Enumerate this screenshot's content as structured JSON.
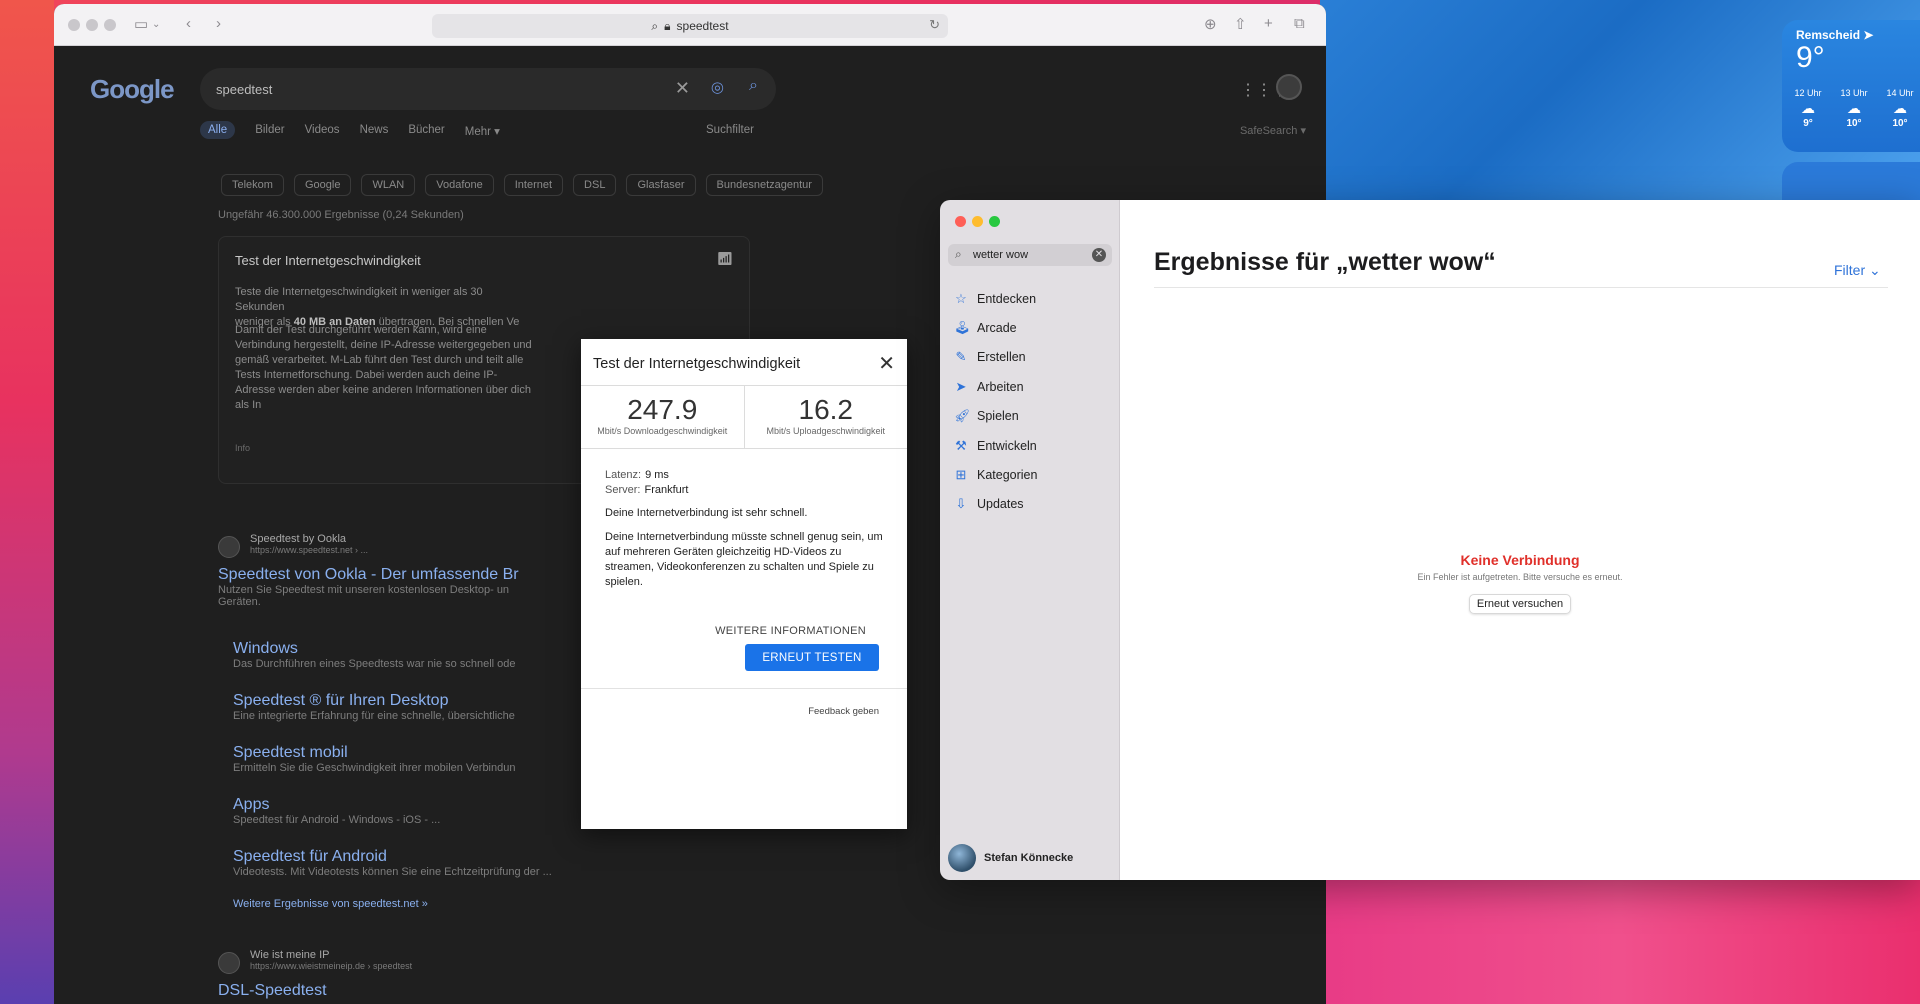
{
  "safari": {
    "url": "speedtest",
    "google": {
      "logo": "Google",
      "query": "speedtest",
      "tabs": [
        "Alle",
        "Bilder",
        "Videos",
        "News",
        "Bücher",
        "Mehr ▾"
      ],
      "filter_label": "Suchfilter",
      "safesearch": "SafeSearch ▾",
      "chips": [
        "Telekom",
        "Google",
        "WLAN",
        "Vodafone",
        "Internet",
        "DSL",
        "Glasfaser",
        "Bundesnetzagentur"
      ],
      "result_count": "Ungefähr 46.300.000 Ergebnisse (0,24 Sekunden)",
      "card": {
        "title": "Test der Internetgeschwindigkeit",
        "p1_line1": "Teste die Internetgeschwindigkeit in weniger als 30 Sekunden",
        "p1_line2_a": "weniger als ",
        "p1_line2_b": "40 MB an Daten",
        "p1_line2_c": " übertragen. Bei schnellen Ve",
        "p2": "Damit der Test durchgeführt werden kann, wird eine Verbindung hergestellt, deine IP-Adresse weitergegeben und gemäß verarbeitet. M-Lab führt den Test durch und teilt alle Tests Internetforschung. Dabei werden auch deine IP-Adresse werden aber keine anderen Informationen über dich als In",
        "info": "Info"
      },
      "results": {
        "ookla_site": "Speedtest by Ookla",
        "ookla_url": "https://www.speedtest.net › ...",
        "ookla_title": "Speedtest von Ookla - Der umfassende Br",
        "ookla_snip": "Nutzen Sie Speedtest mit unseren kostenlosen Desktop- un",
        "ookla_snip2": "Geräten.",
        "sub1_title": "Windows",
        "sub1_snip": "Das Durchführen eines Speedtests war nie so schnell ode",
        "sub2_title": "Speedtest ® für Ihren Desktop",
        "sub2_snip": "Eine integrierte Erfahrung für eine schnelle, übersichtliche",
        "sub3_title": "Speedtest mobil",
        "sub3_snip": "Ermitteln Sie die Geschwindigkeit ihrer mobilen Verbindun",
        "sub4_title": "Apps",
        "sub4_snip": "Speedtest für Android - Windows - iOS - ...",
        "sub5_title": "Speedtest für Android",
        "sub5_snip": "Videotests. Mit Videotests können Sie eine Echtzeitprüfung der ...",
        "more": "Weitere Ergebnisse von speedtest.net »",
        "wie_site": "Wie ist meine IP",
        "wie_url": "https://www.wieistmeineip.de › speedtest",
        "wie_title": "DSL-Speedtest"
      }
    },
    "dialog": {
      "title": "Test der Internetgeschwindigkeit",
      "download_value": "247.9",
      "download_label": "Mbit/s Downloadgeschwindigkeit",
      "upload_value": "16.2",
      "upload_label": "Mbit/s Uploadgeschwindigkeit",
      "latency_label": "Latenz:",
      "latency_value": "9 ms",
      "server_label": "Server:",
      "server_value": "Frankfurt",
      "verdict": "Deine Internetverbindung ist sehr schnell.",
      "description": "Deine Internetverbindung müsste schnell genug sein, um auf mehreren Geräten gleichzeitig HD-Videos zu streamen, Videokonferenzen zu schalten und Spiele zu spielen.",
      "more_info": "WEITERE INFORMATIONEN",
      "retest": "ERNEUT TESTEN",
      "feedback": "Feedback geben"
    }
  },
  "weather": {
    "city": "Remscheid ➤",
    "temp": "9°",
    "hours": [
      {
        "time": "12 Uhr",
        "temp": "9°"
      },
      {
        "time": "13 Uhr",
        "temp": "10°"
      },
      {
        "time": "14 Uhr",
        "temp": "10°"
      }
    ]
  },
  "appstore": {
    "search_value": "wetter wow",
    "nav": [
      {
        "label": "Entdecken",
        "icon": "star-icon"
      },
      {
        "label": "Arcade",
        "icon": "joystick-icon"
      },
      {
        "label": "Erstellen",
        "icon": "brush-icon"
      },
      {
        "label": "Arbeiten",
        "icon": "paperplane-icon"
      },
      {
        "label": "Spielen",
        "icon": "rocket-icon"
      },
      {
        "label": "Entwickeln",
        "icon": "hammer-icon"
      },
      {
        "label": "Kategorien",
        "icon": "grid-icon"
      },
      {
        "label": "Updates",
        "icon": "download-icon"
      }
    ],
    "user": "Stefan Könnecke",
    "title": "Ergebnisse für „wetter wow“",
    "filter": "Filter",
    "error_title": "Keine Verbindung",
    "error_sub": "Ein Fehler ist aufgetreten. Bitte versuche es erneut.",
    "retry": "Erneut versuchen"
  },
  "colors": {
    "accent_blue": "#1a73e8",
    "appstore_blue": "#2f73d8",
    "error_red": "#e0302a"
  }
}
